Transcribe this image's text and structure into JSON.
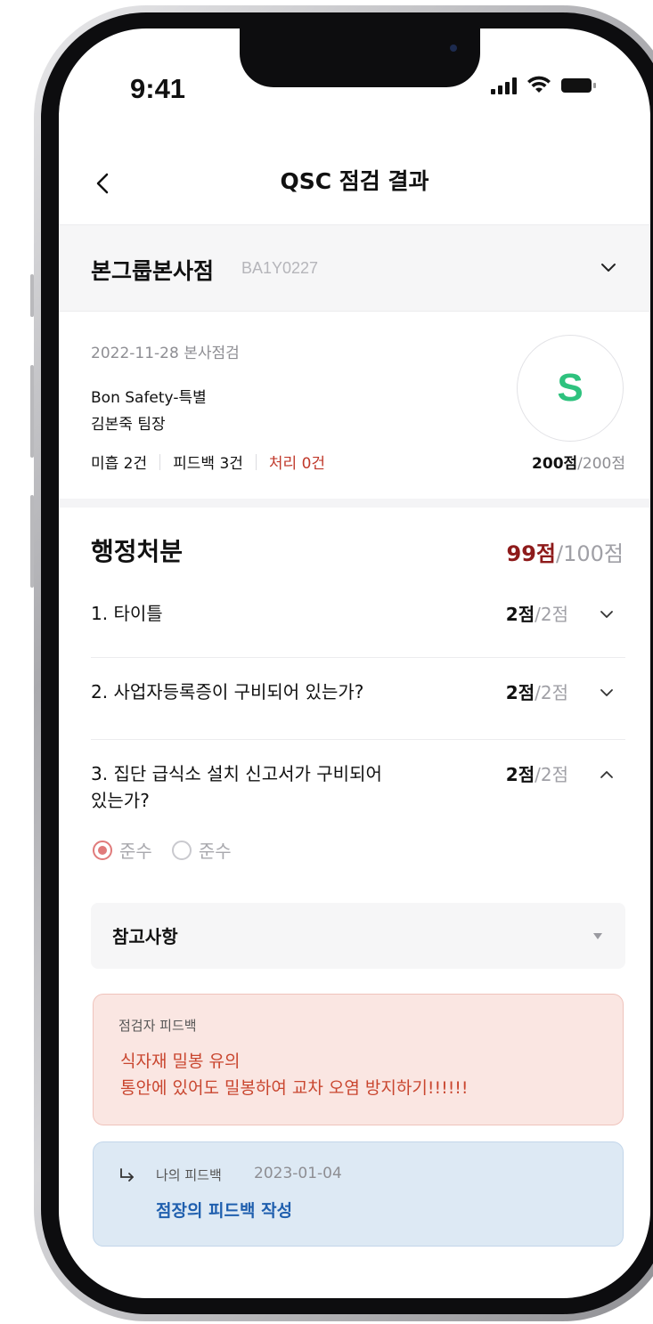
{
  "status_bar": {
    "time": "9:41"
  },
  "header": {
    "title": "QSC 점검 결과"
  },
  "store": {
    "name": "본그룹본사점",
    "code": "BA1Y0227"
  },
  "inspection": {
    "date_type": "2022-11-28 본사점검",
    "program": "Bon Safety-특별",
    "inspector": "김본죽 팀장",
    "counts": {
      "insufficient": "미흡 2건",
      "feedback": "피드백 3건",
      "processed": "처리 0건"
    },
    "grade": "S",
    "score": "200점",
    "score_max": "/200점"
  },
  "section": {
    "title": "행정처분",
    "score": "99점",
    "score_max": "/100점",
    "items": [
      {
        "title": "1. 타이틀",
        "score": "2점",
        "score_max": "/2점"
      },
      {
        "title": "2. 사업자등록증이 구비되어 있는가?",
        "score": "2점",
        "score_max": "/2점"
      },
      {
        "title_line1": "3. 집단 급식소 설치 신고서가 구비되어",
        "title_line2": "있는가?",
        "score": "2점",
        "score_max": "/2점"
      }
    ]
  },
  "radios": [
    {
      "label": "준수",
      "selected": true
    },
    {
      "label": "준수",
      "selected": false
    }
  ],
  "reference": {
    "label": "참고사항"
  },
  "inspector_feedback": {
    "label": "점검자 피드백",
    "line1": "식자재 밀봉 유의",
    "line2": "통안에 있어도 밀봉하여 교차 오염 방지하기!!!!!!"
  },
  "my_feedback": {
    "label": "나의 피드백",
    "date": "2023-01-04",
    "text": "점장의 피드백 작성"
  },
  "colors": {
    "grade": "#2ec27e",
    "section_score": "#8e1b1b",
    "processed": "#c0392b",
    "inspector_feedback_bg": "#fae6e2",
    "my_feedback_bg": "#dde9f4"
  }
}
